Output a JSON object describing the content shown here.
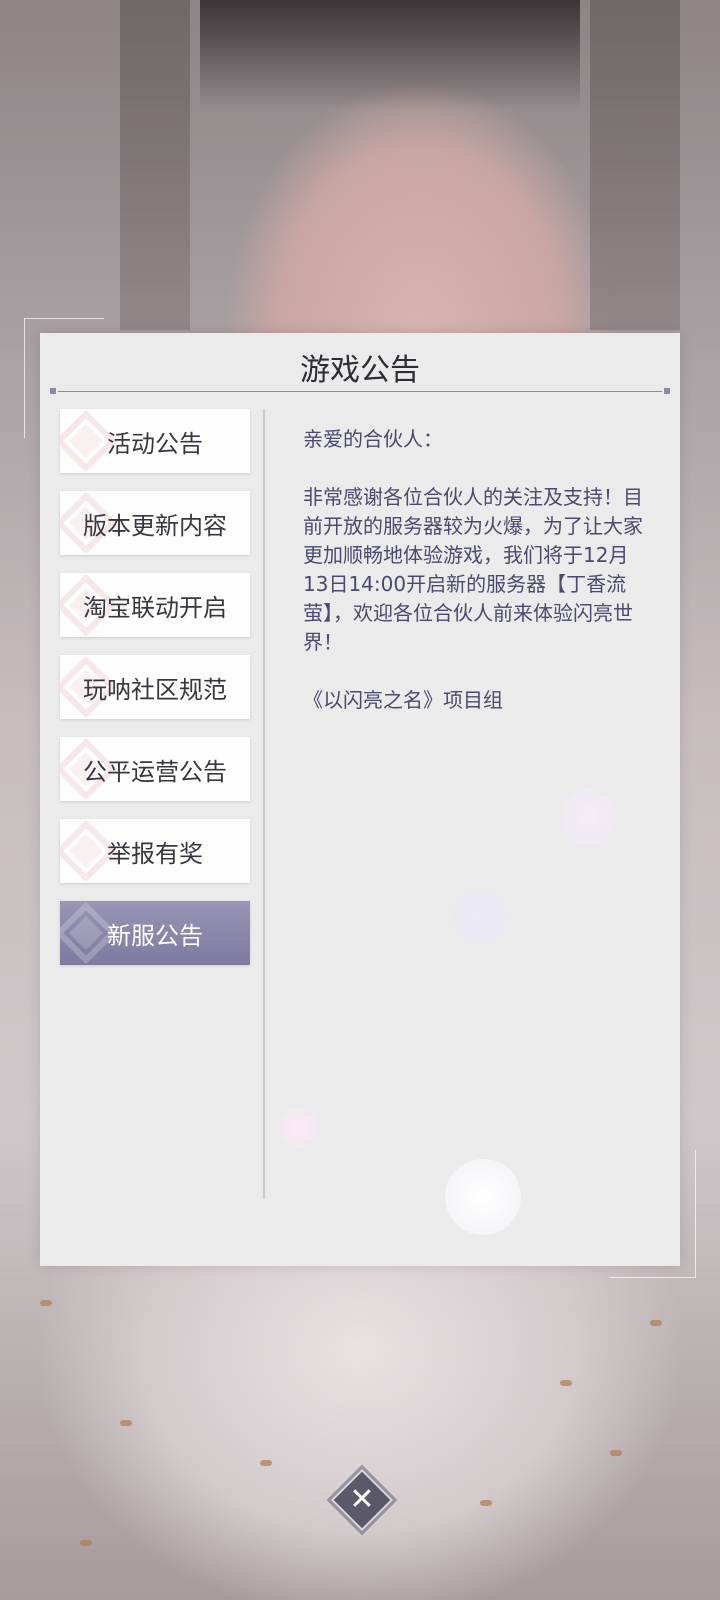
{
  "dialog": {
    "title": "游戏公告",
    "tabs": [
      {
        "label": "活动公告",
        "active": false
      },
      {
        "label": "版本更新内容",
        "active": false
      },
      {
        "label": "淘宝联动开启",
        "active": false
      },
      {
        "label": "玩呐社区规范",
        "active": false
      },
      {
        "label": "公平运营公告",
        "active": false
      },
      {
        "label": "举报有奖",
        "active": false
      },
      {
        "label": "新服公告",
        "active": true
      }
    ],
    "content": {
      "greeting": "亲爱的合伙人：",
      "body": "非常感谢各位合伙人的关注及支持！目前开放的服务器较为火爆，为了让大家更加顺畅地体验游戏，我们将于12月13日14:00开启新的服务器【丁香流萤】，欢迎各位合伙人前来体验闪亮世界！",
      "signature": "《以闪亮之名》项目组"
    },
    "close_icon": "close-icon"
  },
  "colors": {
    "active_tab": "#8884a8",
    "content_text": "#4b4a6e",
    "panel_bg": "#ebebec"
  }
}
